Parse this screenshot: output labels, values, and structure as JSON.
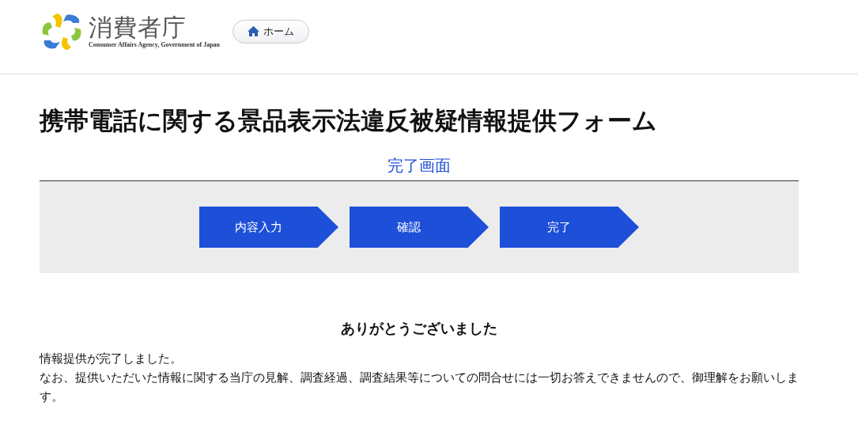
{
  "header": {
    "logo": {
      "name": "消費者庁",
      "subtitle": "Consumer Affairs Agency, Government of Japan"
    },
    "home_button": "ホーム"
  },
  "page_title": "携帯電話に関する景品表示法違反被疑情報提供フォーム",
  "section_title": "完了画面",
  "steps": [
    {
      "label": "内容入力"
    },
    {
      "label": "確認"
    },
    {
      "label": "完了"
    }
  ],
  "message": {
    "heading": "ありがとうございました",
    "paragraphs": [
      "情報提供が完了しました。",
      "なお、提供いただいた情報に関する当庁の見解、調査経過、調査結果等についての問合せには一切お答えできませんので、御理解をお願いします。"
    ]
  }
}
